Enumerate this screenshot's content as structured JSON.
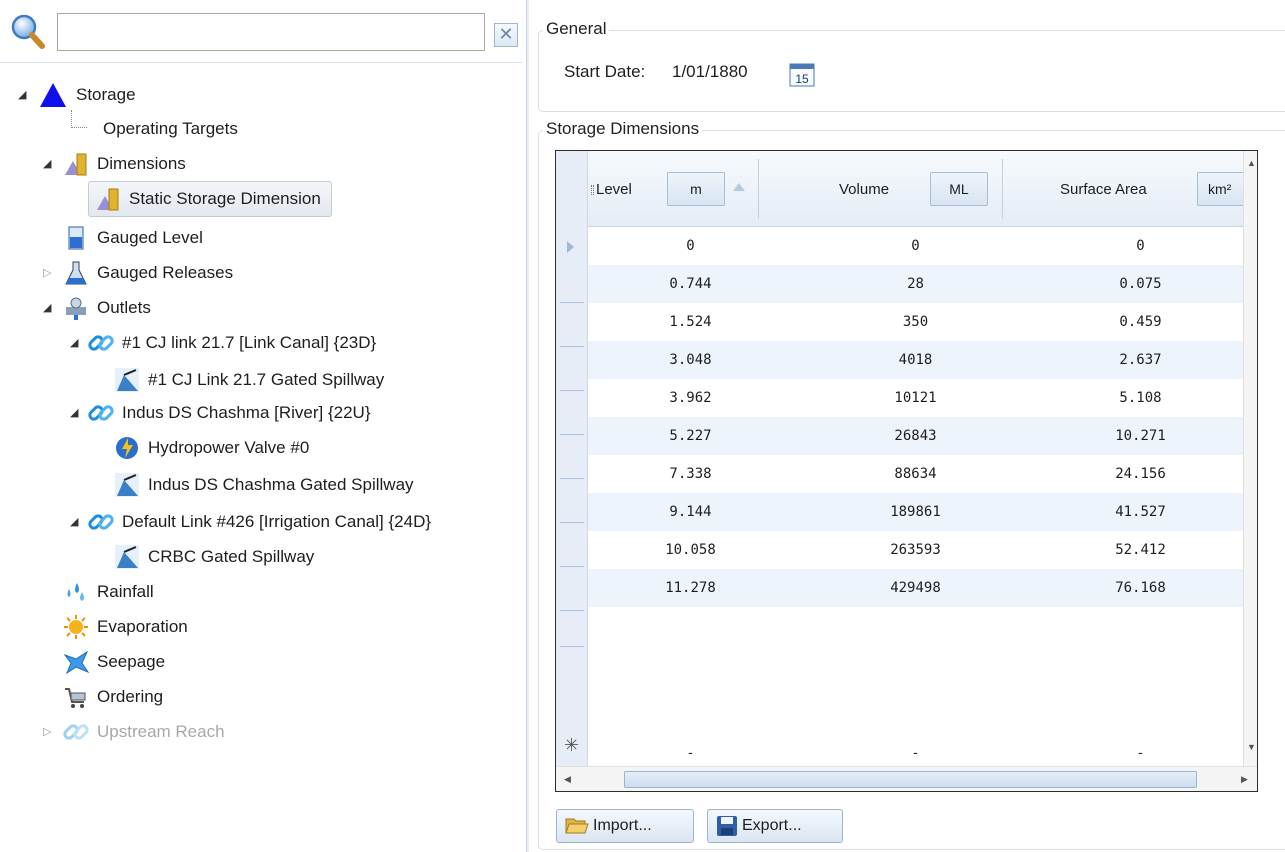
{
  "search": {
    "value": "",
    "clear_glyph": "✕"
  },
  "tree": {
    "storage": "Storage",
    "operating_targets": "Operating Targets",
    "dimensions": "Dimensions",
    "static_storage_dimension": "Static Storage Dimension",
    "gauged_level": "Gauged Level",
    "gauged_releases": "Gauged Releases",
    "outlets": "Outlets",
    "link1": "#1 CJ link 21.7 [Link Canal] {23D}",
    "link1_spillway": "#1 CJ Link 21.7 Gated Spillway",
    "link2": "Indus DS Chashma [River] {22U}",
    "hydropower_valve": "Hydropower Valve #0",
    "link2_spillway": "Indus DS Chashma Gated Spillway",
    "link3": "Default Link #426 [Irrigation Canal] {24D}",
    "link3_spillway": "CRBC Gated Spillway",
    "rainfall": "Rainfall",
    "evaporation": "Evaporation",
    "seepage": "Seepage",
    "ordering": "Ordering",
    "upstream_reach": "Upstream Reach"
  },
  "general": {
    "title": "General",
    "start_date_label": "Start Date:",
    "start_date_value": "1/01/1880",
    "calendar_day": "15"
  },
  "dimensions": {
    "title": "Storage Dimensions",
    "columns": [
      {
        "name": "Level",
        "unit": "m"
      },
      {
        "name": "Volume",
        "unit": "ML"
      },
      {
        "name": "Surface Area",
        "unit": "km²"
      }
    ],
    "rows": [
      [
        "0",
        "0",
        "0"
      ],
      [
        "0.744",
        "28",
        "0.075"
      ],
      [
        "1.524",
        "350",
        "0.459"
      ],
      [
        "3.048",
        "4018",
        "2.637"
      ],
      [
        "3.962",
        "10121",
        "5.108"
      ],
      [
        "5.227",
        "26843",
        "10.271"
      ],
      [
        "7.338",
        "88634",
        "24.156"
      ],
      [
        "9.144",
        "189861",
        "41.527"
      ],
      [
        "10.058",
        "263593",
        "52.412"
      ],
      [
        "11.278",
        "429498",
        "76.168"
      ]
    ],
    "new_row": [
      "-",
      "-",
      "-"
    ],
    "new_row_marker": "✳"
  },
  "actions": {
    "import_label": "Import...",
    "export_label": "Export..."
  },
  "colors": {
    "accent": "#1f6fd1",
    "row_alt": "#eef4fb",
    "header_bg": "#e4ecf6"
  }
}
